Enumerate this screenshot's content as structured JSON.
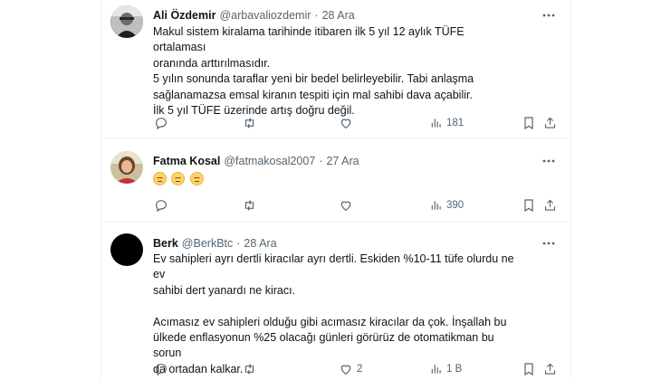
{
  "tweets": [
    {
      "name": "Ali Özdemir",
      "handle": "@arbavaliozdemir",
      "dot": "·",
      "date": "28 Ara",
      "lines": [
        "Makul sistem kiralama tarihinde itibaren ilk 5 yıl 12 aylık TÜFE ortalaması",
        "oranında arttırılmasıdır.",
        "5 yılın sonunda taraflar yeni bir bedel belirleyebilir. Tabi anlaşma",
        "sağlanamazsa emsal kiranın tespiti için mal sahibi dava açabilir.",
        "İlk 5 yıl TÜFE üzerinde artış doğru değil."
      ],
      "replies": "",
      "retweets": "",
      "likes": "",
      "views": "181"
    },
    {
      "name": "Fatma Kosal",
      "handle": "@fatmakosal2007",
      "dot": "·",
      "date": "27 Ara",
      "emoji_count": 3,
      "replies": "",
      "retweets": "",
      "likes": "",
      "views": "390"
    },
    {
      "name": "Berk",
      "handle": "@BerkBtc",
      "dot": "·",
      "date": "28 Ara",
      "lines": [
        "Ev sahipleri ayrı dertli kiracılar ayrı dertli. Eskiden %10-11 tüfe olurdu ne ev",
        "sahibi dert yanardı ne kiracı.",
        "",
        "Acımasız ev sahipleri olduğu gibi acımasız kiracılar da çok. İnşallah bu",
        "ülkede enflasyonun %25 olacağı günleri görürüz de otomatikman bu sorun",
        "da ortadan kalkar."
      ],
      "replies": "",
      "retweets": "",
      "likes": "2",
      "views": "1 B"
    }
  ],
  "icons": {
    "reply": "reply-icon",
    "retweet": "retweet-icon",
    "like": "heart-icon",
    "views": "views-icon",
    "bookmark": "bookmark-icon",
    "share": "share-icon",
    "more": "more-icon"
  },
  "colors": {
    "text": "#0f1419",
    "secondary": "#536471",
    "divider": "#eff3f4"
  }
}
